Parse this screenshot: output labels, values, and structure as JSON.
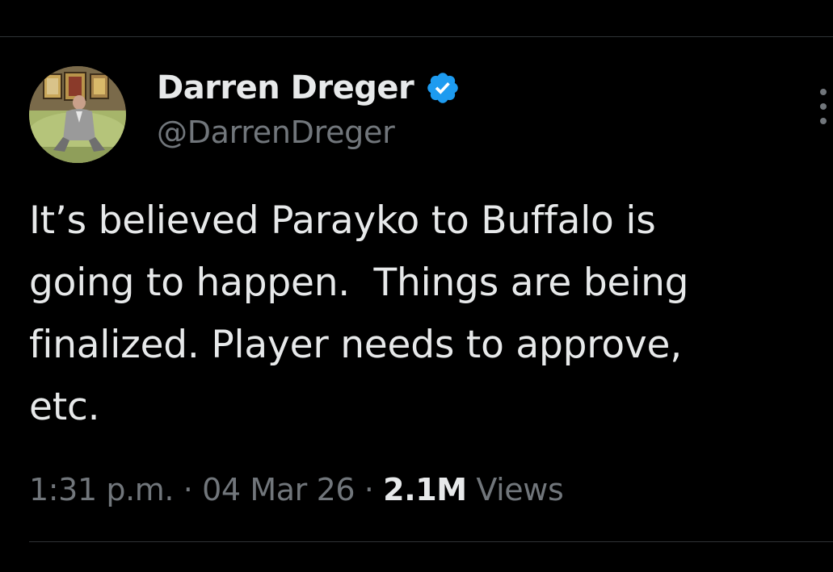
{
  "author": {
    "display_name": "Darren Dreger",
    "handle": "@DarrenDreger",
    "verified_icon": "verified-badge-icon",
    "avatar_icon": "profile-photo"
  },
  "tweet": {
    "lines": [
      "It’s believed Parayko to Buffalo is",
      "going to happen.  Things are being",
      "finalized. Player needs to approve,",
      "etc."
    ]
  },
  "meta": {
    "time": "1:31 p.m.",
    "separator": " · ",
    "date": "04 Mar 26",
    "views_count": "2.1M",
    "views_label": " Views"
  },
  "menu": {
    "icon": "more-options-icon"
  },
  "colors": {
    "background": "#000000",
    "primary_text": "#e7e9ea",
    "secondary_text": "#71767b",
    "verified_blue": "#1d9bf0",
    "divider": "#2f3336"
  }
}
